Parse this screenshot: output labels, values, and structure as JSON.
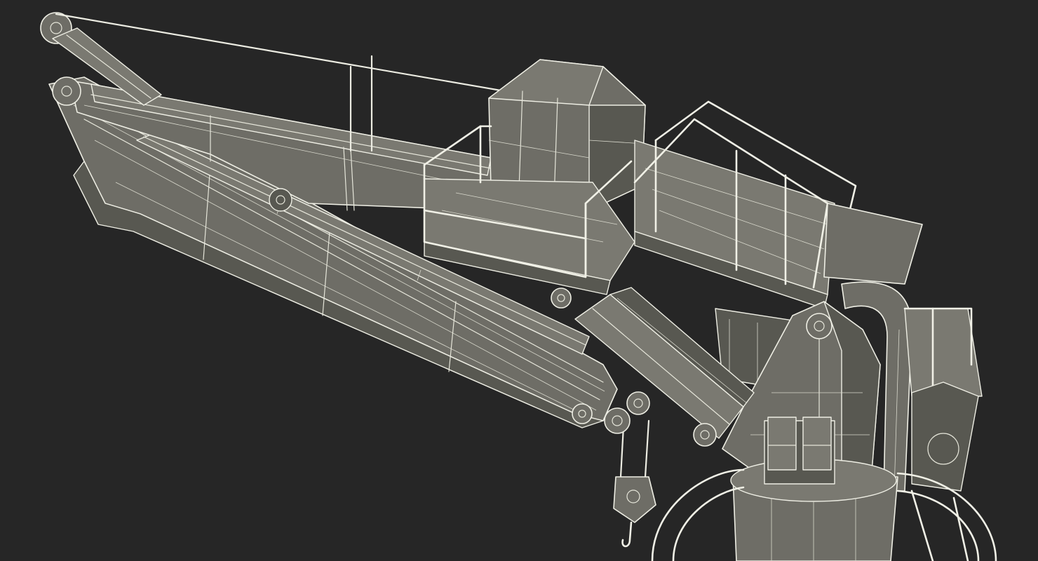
{
  "scene": {
    "subject": "",
    "colors": {
      "background": "#262626",
      "body": "#6e6d66",
      "wireframe": "#eeeee4"
    }
  }
}
